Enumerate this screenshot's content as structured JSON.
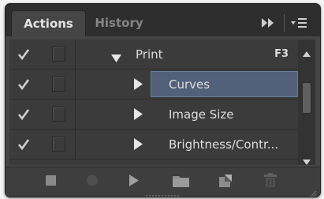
{
  "panel": {
    "tabs": [
      {
        "label": "Actions",
        "active": true
      },
      {
        "label": "History",
        "active": false
      }
    ],
    "header_icons": [
      "expand-panel-icon",
      "panel-menu-icon"
    ]
  },
  "actions": [
    {
      "label": "Print",
      "shortcut": "F3",
      "kind": "set",
      "expanded": true,
      "checked": true
    },
    {
      "label": "Curves",
      "kind": "command",
      "selected": true,
      "checked": true
    },
    {
      "label": "Image Size",
      "kind": "command",
      "selected": false,
      "checked": true
    },
    {
      "label": "Brightness/Contr...",
      "kind": "command",
      "selected": false,
      "checked": true
    }
  ],
  "footer": {
    "buttons": [
      "stop-icon",
      "record-icon",
      "play-icon",
      "folder-icon",
      "new-action-icon",
      "trash-icon"
    ]
  },
  "colors": {
    "panel_bg": "#454545",
    "list_bg": "#3b3b3b",
    "selection": "#526079",
    "text": "#dedede",
    "inactive_tab_text": "#858585"
  }
}
